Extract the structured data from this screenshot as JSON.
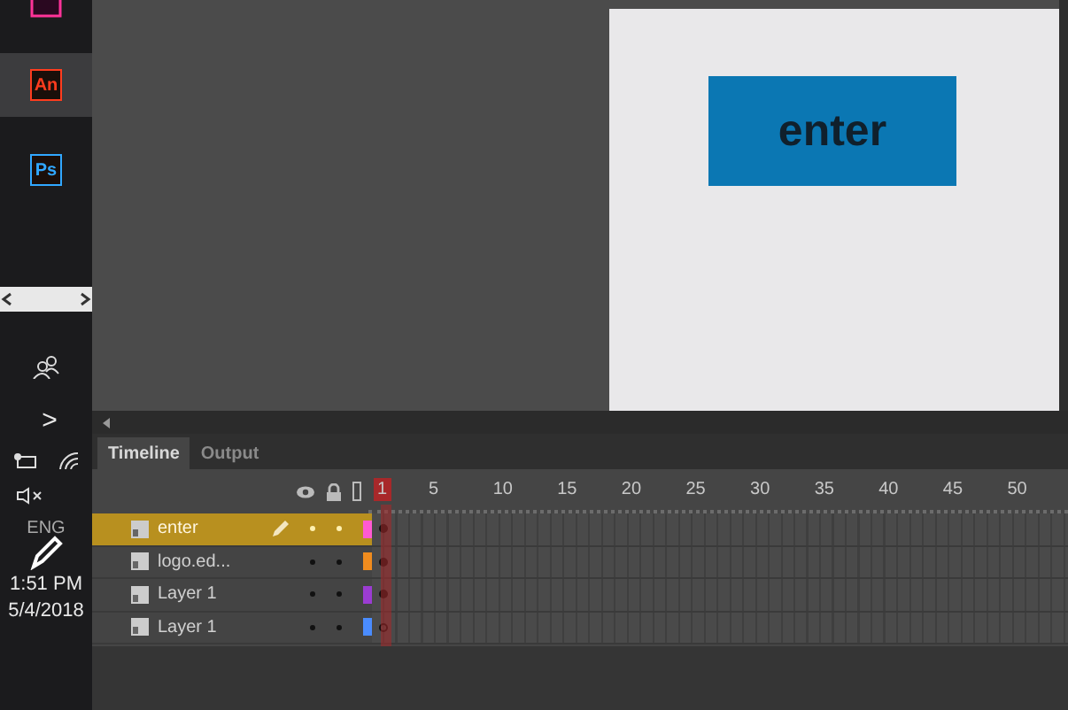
{
  "taskbar": {
    "apps": [
      {
        "label": "An",
        "color": "#ff3c1e",
        "selected": true
      },
      {
        "label": "Ps",
        "color": "#31a8ff",
        "selected": false
      }
    ],
    "tray_chevron": ">",
    "language": "ENG",
    "time": "1:51 PM",
    "date": "5/4/2018",
    "muted": true
  },
  "stage": {
    "button_label": "enter"
  },
  "panel": {
    "tabs": [
      {
        "label": "Timeline",
        "selected": true
      },
      {
        "label": "Output",
        "selected": false
      }
    ]
  },
  "timeline": {
    "frame_labels": [
      {
        "label": "1",
        "selected": true
      },
      {
        "label": "5",
        "selected": false
      },
      {
        "label": "10",
        "selected": false
      },
      {
        "label": "15",
        "selected": false
      },
      {
        "label": "20",
        "selected": false
      },
      {
        "label": "25",
        "selected": false
      },
      {
        "label": "30",
        "selected": false
      },
      {
        "label": "35",
        "selected": false
      },
      {
        "label": "40",
        "selected": false
      },
      {
        "label": "45",
        "selected": false
      },
      {
        "label": "50",
        "selected": false
      }
    ],
    "layers": [
      {
        "name": "enter",
        "selected": true,
        "color": "#ff5ad2",
        "keyframe_filled": true
      },
      {
        "name": "logo.ed...",
        "selected": false,
        "color": "#f08c1e",
        "keyframe_filled": true
      },
      {
        "name": "Layer 1",
        "selected": false,
        "color": "#9b3cd2",
        "keyframe_filled": true
      },
      {
        "name": "Layer 1",
        "selected": false,
        "color": "#4a8cff",
        "keyframe_filled": false
      }
    ]
  }
}
